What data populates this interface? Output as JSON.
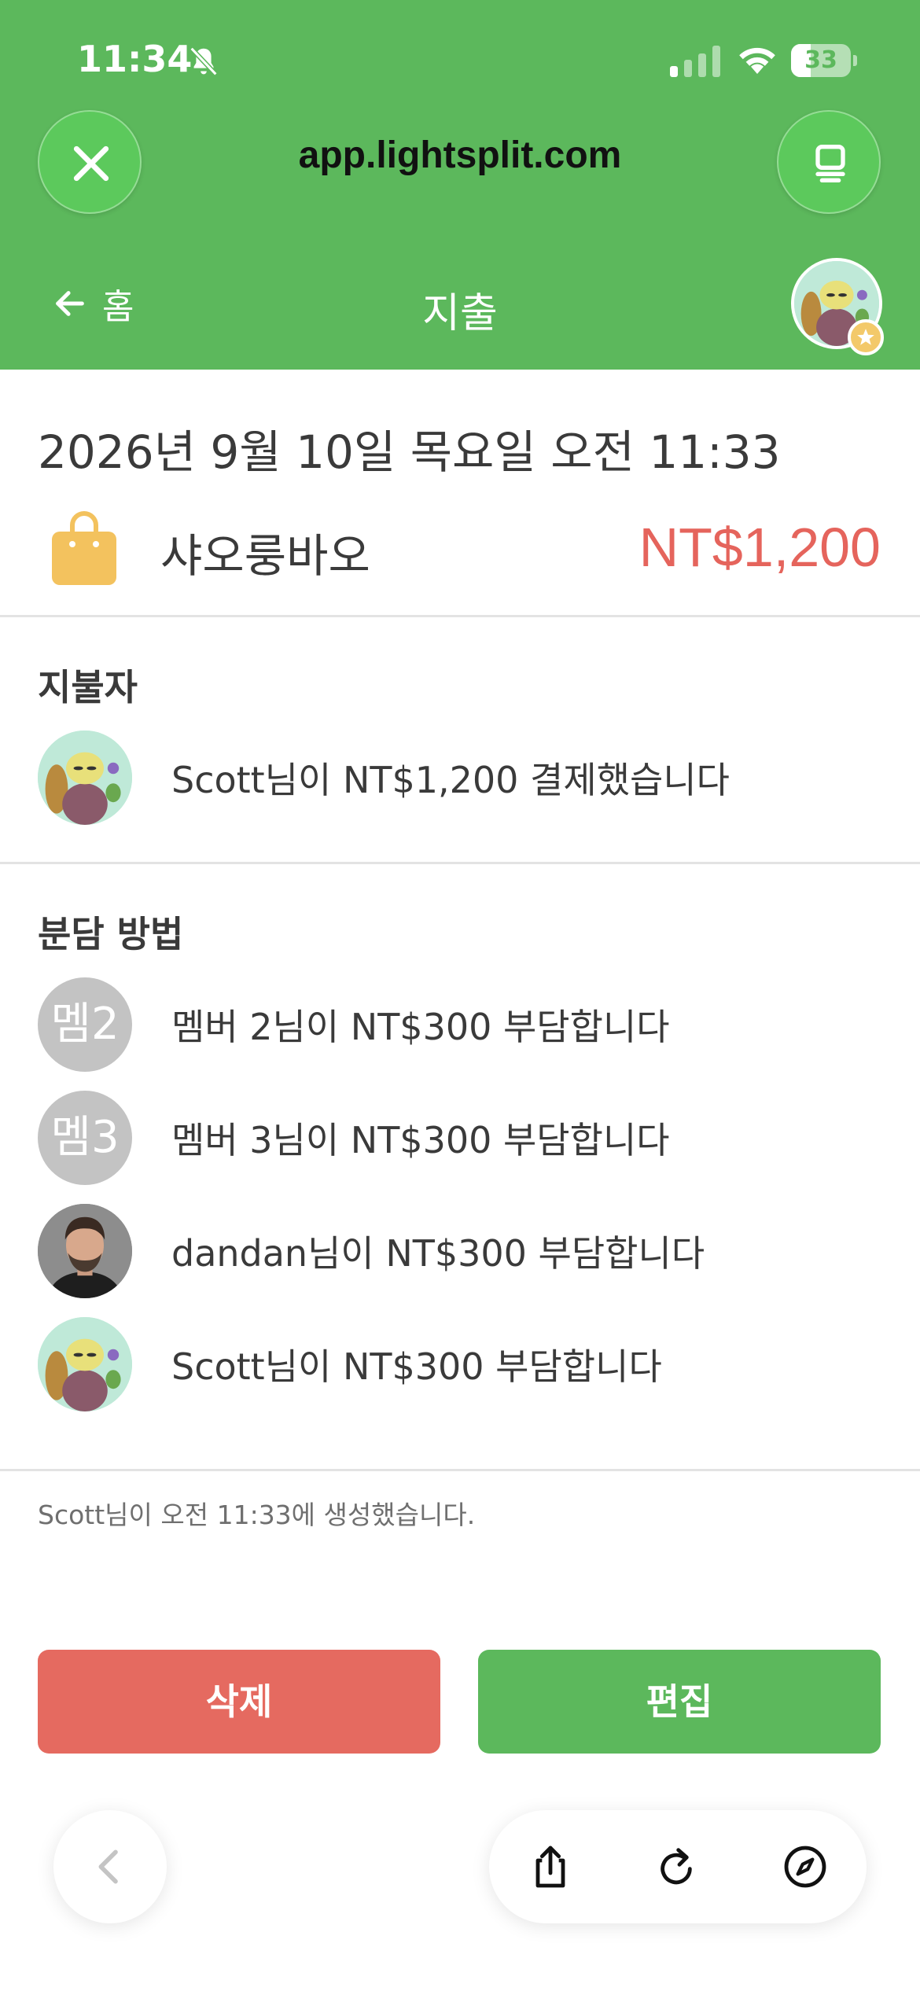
{
  "status_bar": {
    "time": "11:34",
    "battery": "33",
    "battery_level": 0.33
  },
  "browser": {
    "url": "app.lightsplit.com"
  },
  "app_nav": {
    "back_label": "홈",
    "title": "지출"
  },
  "expense": {
    "date": "2026년 9월 10일 목요일 오전 11:33",
    "name": "샤오룽바오",
    "amount": "NT$1,200",
    "icon": "shopping-bag-icon"
  },
  "payer_section": {
    "title": "지불자",
    "rows": [
      {
        "avatar": "creature",
        "text": "Scott님이 NT$1,200 결제했습니다"
      }
    ]
  },
  "split_section": {
    "title": "분담 방법",
    "rows": [
      {
        "avatar_text": "멤2",
        "text": "멤버 2님이 NT$300 부담합니다"
      },
      {
        "avatar_text": "멤3",
        "text": "멤버 3님이 NT$300 부담합니다"
      },
      {
        "avatar": "person",
        "text": "dandan님이 NT$300 부담합니다"
      },
      {
        "avatar": "creature",
        "text": "Scott님이 NT$300 부담합니다"
      }
    ]
  },
  "created_note": "Scott님이 오전 11:33에 생성했습니다.",
  "actions": {
    "delete_label": "삭제",
    "edit_label": "편집"
  },
  "colors": {
    "header_green": "#5cb85c",
    "amount_red": "#e5645c",
    "delete_red": "#e56a60",
    "edit_green": "#5cb85c"
  }
}
